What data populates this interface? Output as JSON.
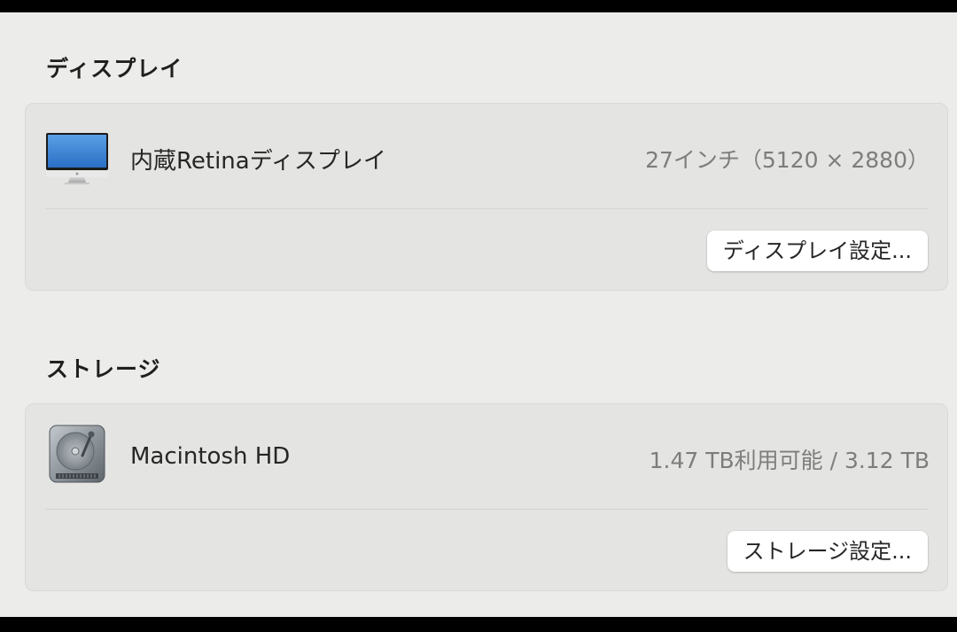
{
  "display_section": {
    "title": "ディスプレイ",
    "item": {
      "icon": "imac-display-icon",
      "label": "内蔵Retinaディスプレイ",
      "value": "27インチ（5120 × 2880）"
    },
    "button_label": "ディスプレイ設定..."
  },
  "storage_section": {
    "title": "ストレージ",
    "item": {
      "icon": "hard-drive-icon",
      "label": "Macintosh HD",
      "value": "1.47 TB利用可能 / 3.12 TB"
    },
    "button_label": "ストレージ設定..."
  }
}
